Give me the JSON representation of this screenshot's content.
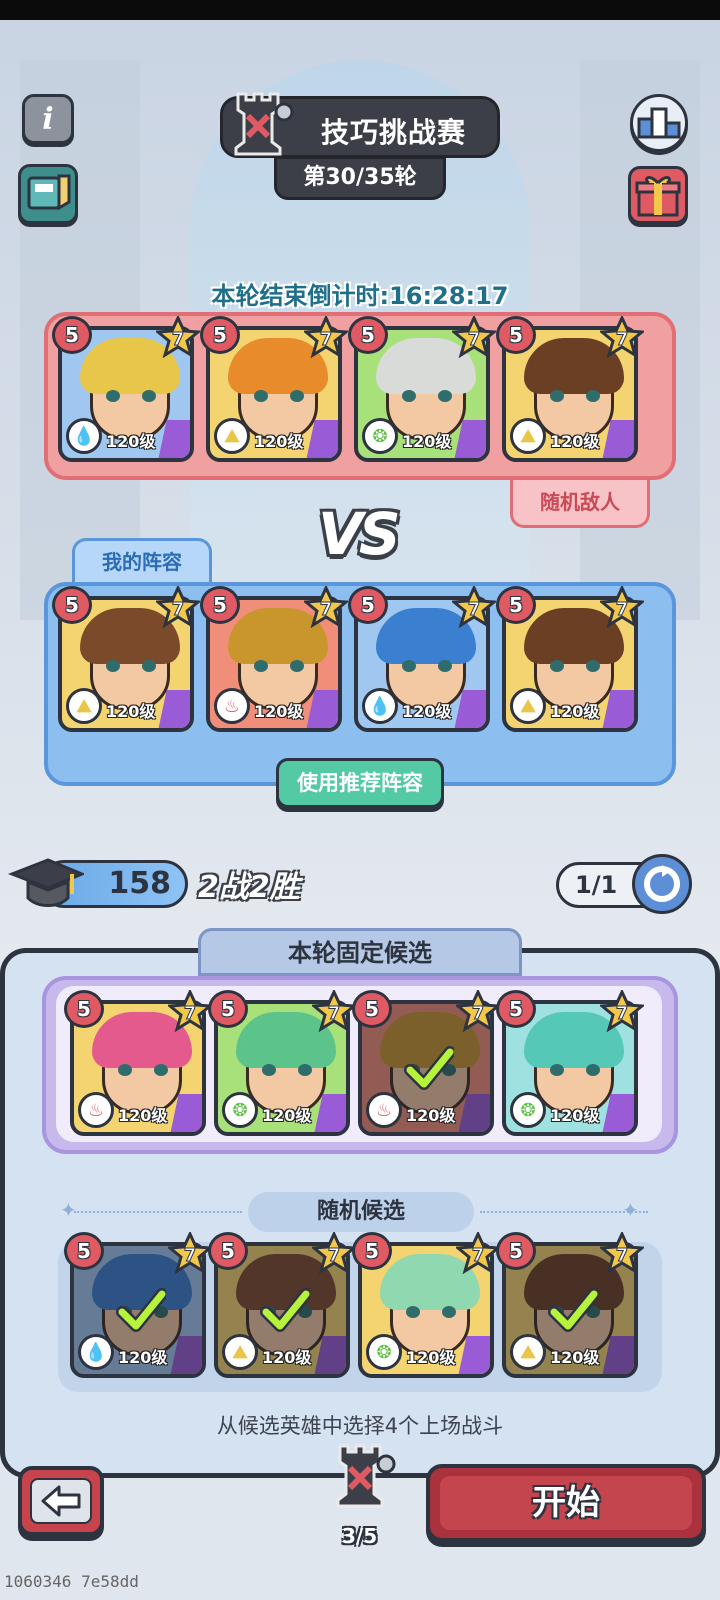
{
  "header": {
    "title": "技巧挑战赛",
    "round": "第30/35轮",
    "countdown": "本轮结束倒计时:16:28:17"
  },
  "icons": {
    "info": "info-icon",
    "guide": "book-icon",
    "rank": "podium-icon",
    "gift": "gift-icon",
    "graduation": "graduation-cap-icon",
    "refresh": "refresh-icon",
    "back": "back-arrow-icon",
    "event": "chess-rook-icon"
  },
  "colors": {
    "fire": "#e05a64",
    "water": "#4fa3e0",
    "wind": "#5cbf45",
    "earth": "#e8c64a",
    "enemy_panel": "#f0a0a0",
    "my_panel": "#8cbef0"
  },
  "enemy": {
    "tab_label": "随机敌人",
    "heroes": [
      {
        "star": "5",
        "grade": "7",
        "level": "120级",
        "element": "water",
        "hair": "#e8c64a",
        "bg": "#9fc7f0"
      },
      {
        "star": "5",
        "grade": "7",
        "level": "120级",
        "element": "earth",
        "hair": "#e88b2a",
        "bg": "#f4d470"
      },
      {
        "star": "5",
        "grade": "7",
        "level": "120级",
        "element": "wind",
        "hair": "#d8dbd8",
        "bg": "#a8e07a"
      },
      {
        "star": "5",
        "grade": "7",
        "level": "120级",
        "element": "earth",
        "hair": "#6b3f24",
        "bg": "#f4d470"
      }
    ]
  },
  "vs_label": "VS",
  "mine": {
    "tab_label": "我的阵容",
    "recommend_button": "使用推荐阵容",
    "heroes": [
      {
        "star": "5",
        "grade": "7",
        "level": "120级",
        "element": "earth",
        "hair": "#7a4a2a",
        "bg": "#f4d470"
      },
      {
        "star": "5",
        "grade": "7",
        "level": "120级",
        "element": "fire",
        "hair": "#c9962e",
        "bg": "#f08e7a"
      },
      {
        "star": "5",
        "grade": "7",
        "level": "120级",
        "element": "water",
        "hair": "#3a7fd0",
        "bg": "#9fc7f0"
      },
      {
        "star": "5",
        "grade": "7",
        "level": "120级",
        "element": "earth",
        "hair": "#6b3f24",
        "bg": "#f4d470"
      }
    ]
  },
  "stats": {
    "points": "158",
    "record": "2战2胜",
    "refresh_count": "1/1"
  },
  "candidates": {
    "fixed_label": "本轮固定候选",
    "random_label": "随机候选",
    "hint": "从候选英雄中选择4个上场战斗",
    "fixed": [
      {
        "star": "5",
        "grade": "7",
        "level": "120级",
        "element": "fire",
        "hair": "#e45a8c",
        "bg": "#f4d470",
        "selected": false
      },
      {
        "star": "5",
        "grade": "7",
        "level": "120级",
        "element": "wind",
        "hair": "#5cc48a",
        "bg": "#a8e07a",
        "selected": false
      },
      {
        "star": "5",
        "grade": "7",
        "level": "120级",
        "element": "fire",
        "hair": "#c9962e",
        "bg": "#f08e7a",
        "selected": true
      },
      {
        "star": "5",
        "grade": "7",
        "level": "120级",
        "element": "wind",
        "hair": "#55c8b8",
        "bg": "#9fe0e0",
        "selected": false
      }
    ],
    "random": [
      {
        "star": "5",
        "grade": "7",
        "level": "120级",
        "element": "water",
        "hair": "#3a7fd0",
        "bg": "#9fc7f0",
        "selected": true
      },
      {
        "star": "5",
        "grade": "7",
        "level": "120级",
        "element": "earth",
        "hair": "#7a4a2a",
        "bg": "#f4d470",
        "selected": true
      },
      {
        "star": "5",
        "grade": "7",
        "level": "120级",
        "element": "wind",
        "hair": "#8fd8b0",
        "bg": "#f4d470",
        "selected": false
      },
      {
        "star": "5",
        "grade": "7",
        "level": "120级",
        "element": "earth",
        "hair": "#6b3f24",
        "bg": "#f4d470",
        "selected": true
      }
    ]
  },
  "footer": {
    "start_button": "开始",
    "progress": "3/5"
  },
  "debug_text": "1060346 7e58dd"
}
